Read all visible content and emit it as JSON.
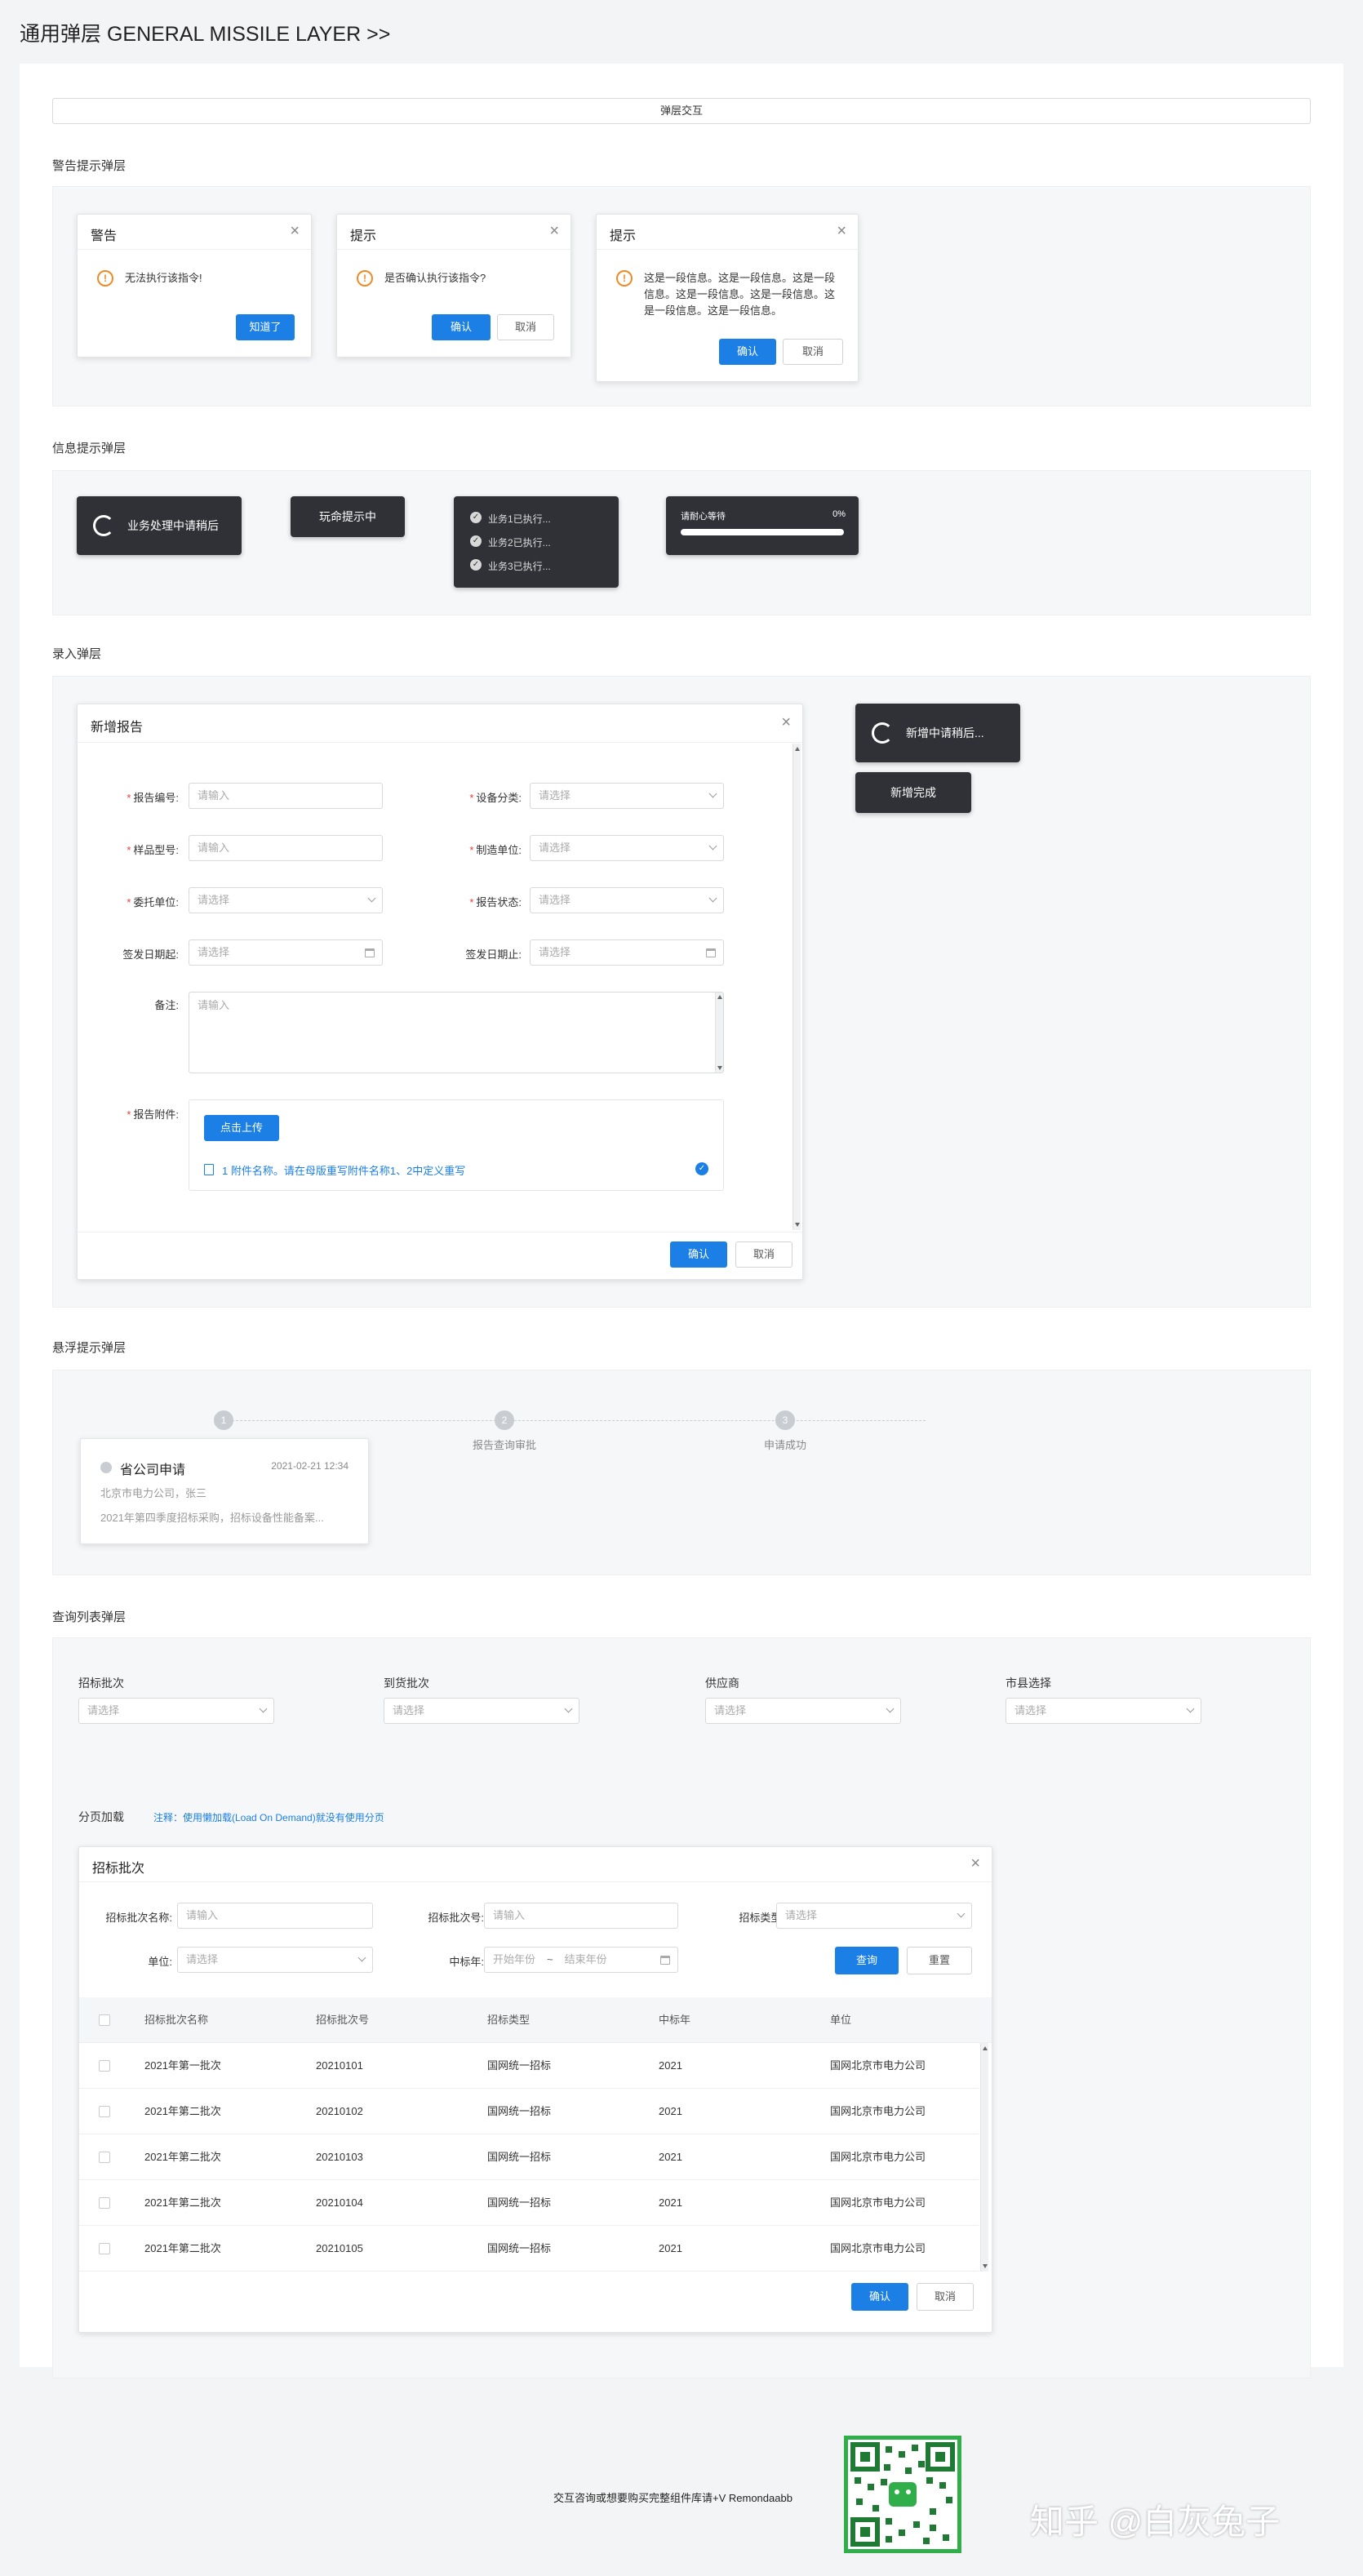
{
  "page": {
    "title": "通用弹层  GENERAL MISSILE LAYER >>",
    "header_button": "弹层交互"
  },
  "colors": {
    "primary": "#1b7fe5",
    "warning": "#f08a24",
    "toast_bg": "#2f3136",
    "required": "#e23b3b"
  },
  "sections": {
    "alert": "警告提示弹层",
    "info": "信息提示弹层",
    "entry": "录入弹层",
    "hover": "悬浮提示弹层",
    "query": "查询列表弹层"
  },
  "alerts": [
    {
      "title": "警告",
      "message": "无法执行该指令!",
      "confirm": "知道了"
    },
    {
      "title": "提示",
      "message": "是否确认执行该指令?",
      "confirm": "确认",
      "cancel": "取消"
    },
    {
      "title": "提示",
      "message": "这是一段信息。这是一段信息。这是一段信息。这是一段信息。这是一段信息。这是一段信息。这是一段信息。",
      "confirm": "确认",
      "cancel": "取消"
    }
  ],
  "toasts": {
    "loading": "业务处理中请稍后",
    "tip": "玩命提示中",
    "steps": [
      "业务1已执行...",
      "业务2已执行...",
      "业务3已执行..."
    ],
    "progress_label": "请耐心等待",
    "progress_text": "0%",
    "progress_value": 0
  },
  "entry_dialog": {
    "title": "新增报告",
    "fields": {
      "report_no": {
        "label": "报告编号:",
        "placeholder": "请输入"
      },
      "device_type": {
        "label": "设备分类:",
        "placeholder": "请选择"
      },
      "sample_model": {
        "label": "样品型号:",
        "placeholder": "请输入"
      },
      "manufacturer": {
        "label": "制造单位:",
        "placeholder": "请选择"
      },
      "client": {
        "label": "委托单位:",
        "placeholder": "请选择"
      },
      "report_status": {
        "label": "报告状态:",
        "placeholder": "请选择"
      },
      "issue_start": {
        "label": "签发日期起:",
        "placeholder": "请选择"
      },
      "issue_end": {
        "label": "签发日期止:",
        "placeholder": "请选择"
      },
      "remark": {
        "label": "备注:",
        "placeholder": "请输入"
      },
      "attachment": {
        "label": "报告附件:",
        "upload": "点击上传",
        "file": "1 附件名称。请在母版重写附件名称1、2中定义重写"
      }
    },
    "confirm": "确认",
    "cancel": "取消"
  },
  "entry_toasts": {
    "loading": "新增中请稍后...",
    "done": "新增完成"
  },
  "hover": {
    "steps": [
      {
        "num": "1",
        "label": ""
      },
      {
        "num": "2",
        "label": "报告查询审批"
      },
      {
        "num": "3",
        "label": "申请成功"
      }
    ],
    "card": {
      "title": "省公司申请",
      "time": "2021-02-21 12:34",
      "line1": "北京市电力公司，张三",
      "line2": "2021年第四季度招标采购，招标设备性能备案..."
    }
  },
  "query": {
    "filters": [
      {
        "label": "招标批次",
        "placeholder": "请选择"
      },
      {
        "label": "到货批次",
        "placeholder": "请选择"
      },
      {
        "label": "供应商",
        "placeholder": "请选择"
      },
      {
        "label": "市县选择",
        "placeholder": "请选择"
      }
    ],
    "paging_label": "分页加载",
    "paging_note": "注释：使用懒加载(Load On Demand)就没有使用分页",
    "dialog": {
      "title": "招标批次",
      "search": {
        "batch_name": {
          "label": "招标批次名称:",
          "placeholder": "请输入"
        },
        "batch_no": {
          "label": "招标批次号:",
          "placeholder": "请输入"
        },
        "bid_type": {
          "label": "招标类型:",
          "placeholder": "请选择"
        },
        "unit": {
          "label": "单位:",
          "placeholder": "请选择"
        },
        "year": {
          "label": "中标年:",
          "start": "开始年份",
          "sep": "~",
          "end": "结束年份"
        },
        "query": "查询",
        "reset": "重置"
      },
      "columns": [
        "招标批次名称",
        "招标批次号",
        "招标类型",
        "中标年",
        "单位"
      ],
      "rows": [
        [
          "2021年第一批次",
          "20210101",
          "国网统一招标",
          "2021",
          "国网北京市电力公司"
        ],
        [
          "2021年第二批次",
          "20210102",
          "国网统一招标",
          "2021",
          "国网北京市电力公司"
        ],
        [
          "2021年第二批次",
          "20210103",
          "国网统一招标",
          "2021",
          "国网北京市电力公司"
        ],
        [
          "2021年第二批次",
          "20210104",
          "国网统一招标",
          "2021",
          "国网北京市电力公司"
        ],
        [
          "2021年第二批次",
          "20210105",
          "国网统一招标",
          "2021",
          "国网北京市电力公司"
        ]
      ],
      "confirm": "确认",
      "cancel": "取消"
    }
  },
  "footer": {
    "contact": "交互咨询或想要购买完整组件库请+V Remondaabb",
    "watermark": "知乎 @白灰兔子",
    "qr_caption": ""
  }
}
